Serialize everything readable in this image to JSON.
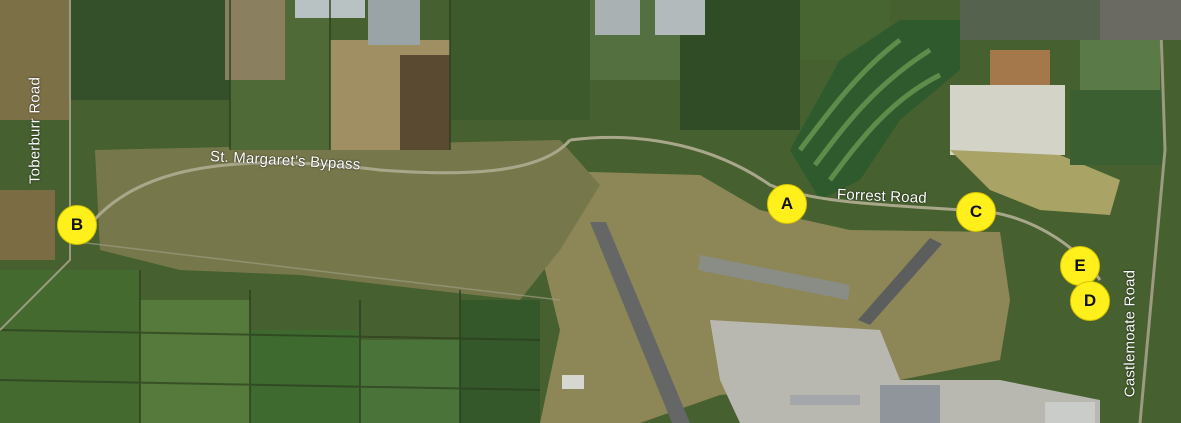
{
  "map": {
    "roads": {
      "toberburr": "Toberburr Road",
      "bypass": "St. Margaret’s Bypass",
      "forrest": "Forrest Road",
      "castlemoate": "Castlemoate Road"
    },
    "markers": {
      "a": "A",
      "b": "B",
      "c": "C",
      "d": "D",
      "e": "E"
    },
    "colors": {
      "marker_fill": "#ffef1a",
      "label_text": "#ffffff",
      "field_dark": "#3f5a2c",
      "field_light": "#8a8a58",
      "runway": "#6b6e6b"
    }
  }
}
